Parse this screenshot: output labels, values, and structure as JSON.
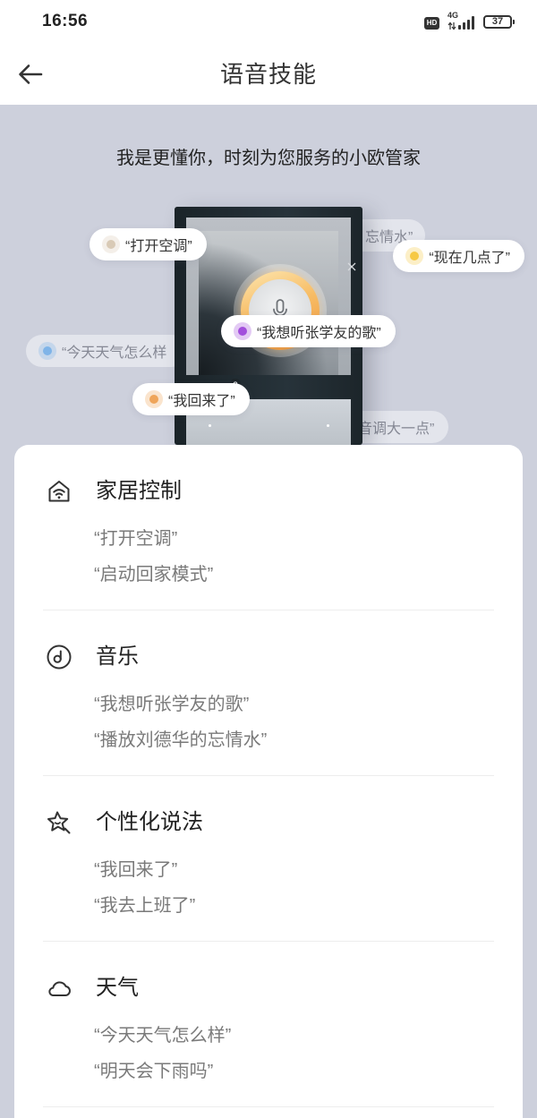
{
  "status_bar": {
    "time": "16:56",
    "hd_badge": "HD",
    "network_type": "4G",
    "battery_level": "37"
  },
  "header": {
    "title": "语音技能",
    "back_icon": "back-arrow-icon"
  },
  "hero": {
    "tagline": "我是更懂你，时刻为您服务的小欧管家",
    "chips": [
      {
        "text": "“打开空调”",
        "dot_color": "#d9cab6"
      },
      {
        "text": "“现在几点了”",
        "dot_color": "#f6c945"
      },
      {
        "text": "“我想听张学友的歌”",
        "dot_color": "#a24fdc"
      },
      {
        "text": "“我回来了”",
        "dot_color": "#efa55a"
      }
    ],
    "faded_chips": [
      {
        "text": "“今天天气怎么样",
        "dot_color": "#7fb4e8"
      },
      {
        "text": "忘情水”"
      },
      {
        "text": "音调大一点”"
      }
    ],
    "device_icons": [
      "microphone-icon",
      "close-icon",
      "help-icon"
    ]
  },
  "skills": [
    {
      "title": "家居控制",
      "icon": "smart-home-icon",
      "examples": [
        "“打开空调”",
        "“启动回家模式”"
      ]
    },
    {
      "title": "音乐",
      "icon": "music-disc-icon",
      "examples": [
        "“我想听张学友的歌”",
        "“播放刘德华的忘情水”"
      ]
    },
    {
      "title": "个性化说法",
      "icon": "personalized-star-icon",
      "examples": [
        "“我回来了”",
        "“我去上班了”"
      ]
    },
    {
      "title": "天气",
      "icon": "cloud-icon",
      "examples": [
        "“今天天气怎么样”",
        "“明天会下雨吗”"
      ]
    }
  ],
  "colors": {
    "hero_background": "#cdd0dc",
    "mic_ring_accent": "#f3a345"
  }
}
